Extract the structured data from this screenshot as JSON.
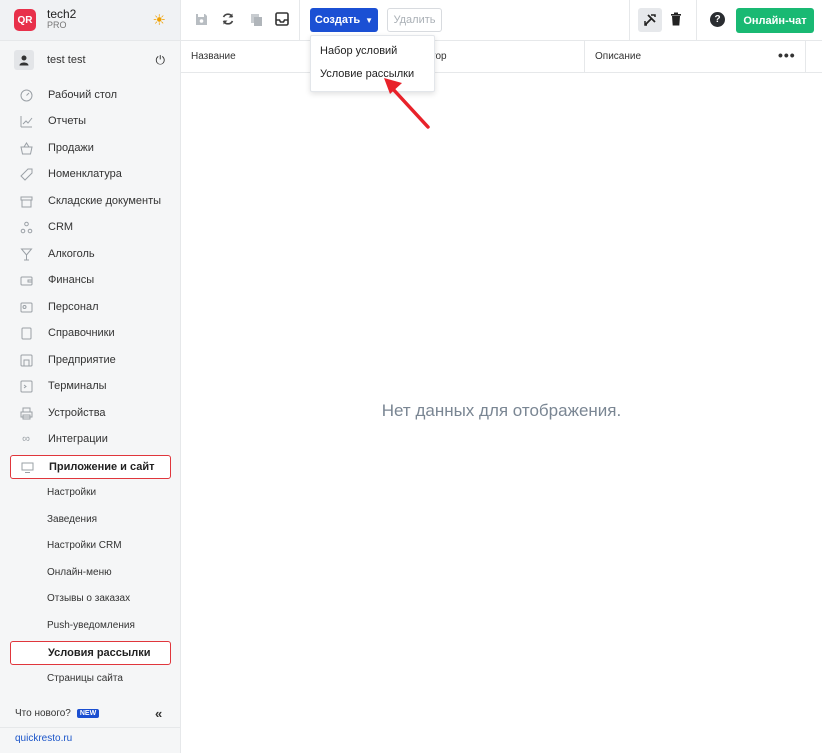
{
  "brand": {
    "logo": "QR",
    "name": "tech2",
    "plan": "PRO"
  },
  "user": {
    "name": "test test"
  },
  "nav": [
    {
      "label": "Рабочий стол",
      "icon": "dashboard-icon"
    },
    {
      "label": "Отчеты",
      "icon": "reports-icon"
    },
    {
      "label": "Продажи",
      "icon": "basket-icon"
    },
    {
      "label": "Номенклатура",
      "icon": "tag-icon"
    },
    {
      "label": "Складские документы",
      "icon": "warehouse-icon"
    },
    {
      "label": "CRM",
      "icon": "crm-icon"
    },
    {
      "label": "Алкоголь",
      "icon": "glass-icon"
    },
    {
      "label": "Финансы",
      "icon": "wallet-icon"
    },
    {
      "label": "Персонал",
      "icon": "people-icon"
    },
    {
      "label": "Справочники",
      "icon": "book-icon"
    },
    {
      "label": "Предприятие",
      "icon": "store-icon"
    },
    {
      "label": "Терминалы",
      "icon": "terminal-icon"
    },
    {
      "label": "Устройства",
      "icon": "printer-icon"
    },
    {
      "label": "Интеграции",
      "icon": "infinity-icon"
    }
  ],
  "active_section": {
    "label": "Приложение и сайт",
    "icon": "monitor-icon"
  },
  "subitems": [
    "Настройки",
    "Заведения",
    "Настройки CRM",
    "Онлайн-меню",
    "Отзывы о заказах",
    "Push-уведомления"
  ],
  "active_subitem": "Условия рассылки",
  "last_subitem": "Страницы сайта",
  "footer": {
    "whats_new": "Что нового?",
    "badge": "NEW",
    "collapse": "«",
    "link": "quickresto.ru"
  },
  "toolbar": {
    "create": "Создать",
    "delete": "Удалить",
    "chat": "Онлайн-чат",
    "help": "?"
  },
  "table": {
    "columns": [
      "Название",
      "тор",
      "Описание"
    ],
    "more": "•••"
  },
  "dropdown": {
    "items": [
      "Набор условий",
      "Условие рассылки"
    ]
  },
  "empty_text": "Нет данных для отображения.",
  "colors": {
    "primary": "#1b50d4",
    "success": "#19b973",
    "highlight": "#e0363c"
  }
}
